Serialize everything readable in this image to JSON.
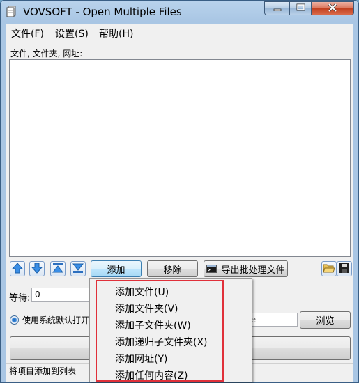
{
  "window": {
    "title": "VOVSOFT - Open Multiple Files"
  },
  "menu": {
    "file": "文件(F)",
    "settings": "设置(S)",
    "help": "帮助(H)"
  },
  "list": {
    "label": "文件, 文件夹, 网址:"
  },
  "toolbar": {
    "add": "添加",
    "remove": "移除",
    "export": "导出批处理文件"
  },
  "options": {
    "wait_label": "等待:",
    "wait_value": "0",
    "radio_label": "使用系统默认打开",
    "path_partial": "xe",
    "browse": "浏览"
  },
  "status": {
    "text": "将项目添加到列表"
  },
  "add_menu": {
    "items": [
      "添加文件(U)",
      "添加文件夹(V)",
      "添加子文件夹(W)",
      "添加递归子文件夹(X)",
      "添加网址(Y)",
      "添加任何内容(Z)"
    ]
  },
  "colors": {
    "highlight_border": "#e0303a",
    "close_button": "#c2401f",
    "window_frame": "#a9c6e4"
  },
  "icons": [
    "app-file-icon",
    "minimize-icon",
    "maximize-icon",
    "close-icon",
    "move-up-icon",
    "move-down-icon",
    "move-top-icon",
    "move-bottom-icon",
    "console-icon",
    "open-folder-icon",
    "save-icon"
  ]
}
